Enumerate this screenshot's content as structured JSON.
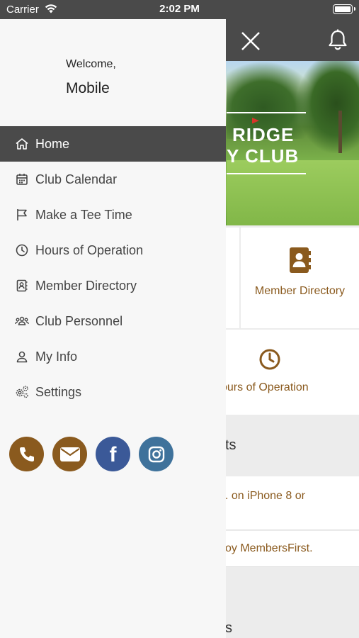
{
  "status_bar": {
    "carrier": "Carrier",
    "time": "2:02 PM"
  },
  "drawer": {
    "welcome": "Welcome,",
    "username": "Mobile",
    "menu": [
      {
        "label": "Home",
        "icon": "home-icon",
        "active": true
      },
      {
        "label": "Club Calendar",
        "icon": "calendar-icon",
        "active": false
      },
      {
        "label": "Make a Tee Time",
        "icon": "flag-icon",
        "active": false
      },
      {
        "label": "Hours of Operation",
        "icon": "clock-icon",
        "active": false
      },
      {
        "label": "Member Directory",
        "icon": "contact-book-icon",
        "active": false
      },
      {
        "label": "Club Personnel",
        "icon": "users-icon",
        "active": false
      },
      {
        "label": "My Info",
        "icon": "user-icon",
        "active": false
      },
      {
        "label": "Settings",
        "icon": "gears-icon",
        "active": false
      }
    ],
    "social": [
      {
        "name": "phone",
        "icon": "phone-icon",
        "color": "#8a5a1e"
      },
      {
        "name": "email",
        "icon": "envelope-icon",
        "color": "#8a5a1e"
      },
      {
        "name": "facebook",
        "icon": "facebook-icon",
        "color": "#3b5998"
      },
      {
        "name": "instagram",
        "icon": "instagram-icon",
        "color": "#3f729b"
      }
    ]
  },
  "background_app": {
    "hero_logo_line1": "RIDGE",
    "hero_logo_line2": "Y CLUB",
    "tiles": {
      "member_directory": "Member Directory",
      "hours": "ours of Operation"
    },
    "section1_title": "ts",
    "news": [
      ". on iPhone 8 or",
      "oy MembersFirst."
    ],
    "section2_title": "s"
  },
  "colors": {
    "header": "#4a4a4a",
    "accent": "#8a5a1e",
    "drawer_bg": "#f7f7f7"
  }
}
